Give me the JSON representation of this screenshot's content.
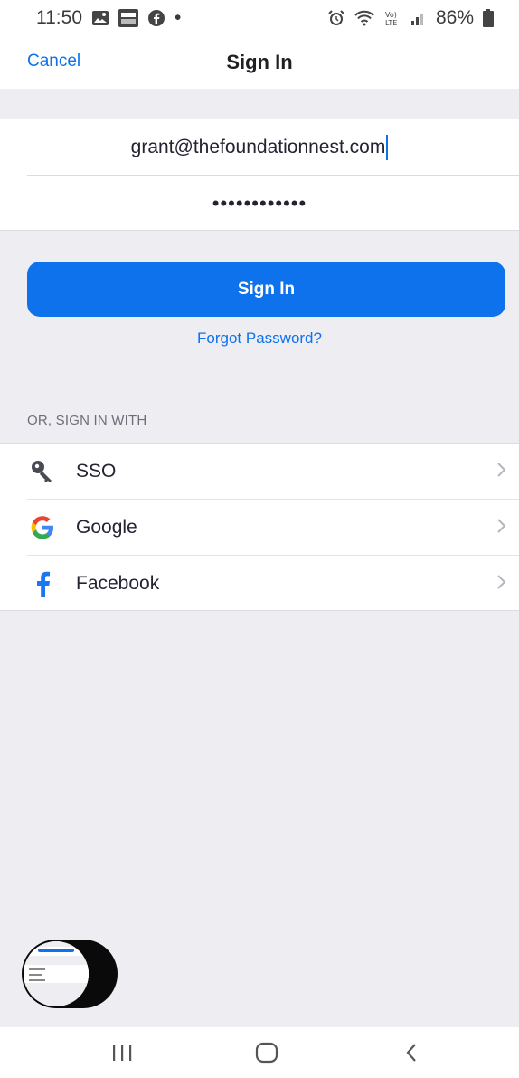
{
  "status_bar": {
    "time": "11:50",
    "battery": "86%",
    "dot": "•",
    "icons_left": [
      "gallery-icon",
      "fox-news-icon",
      "facebook-notification-icon"
    ],
    "icons_right": [
      "alarm-icon",
      "wifi-icon",
      "volte-icon",
      "signal-icon",
      "battery-icon"
    ]
  },
  "header": {
    "cancel_label": "Cancel",
    "title": "Sign In"
  },
  "form": {
    "email_value": "grant@thefoundationnest.com",
    "password_value": "••••••••••••"
  },
  "actions": {
    "signin_label": "Sign In",
    "forgot_label": "Forgot Password?"
  },
  "alt_signin": {
    "section_label": "OR, SIGN IN WITH",
    "providers": [
      {
        "label": "SSO",
        "icon": "key-icon"
      },
      {
        "label": "Google",
        "icon": "google-icon"
      },
      {
        "label": "Facebook",
        "icon": "facebook-icon"
      }
    ]
  },
  "colors": {
    "accent": "#0e72ed",
    "background": "#eeeef2",
    "text": "#232333"
  }
}
